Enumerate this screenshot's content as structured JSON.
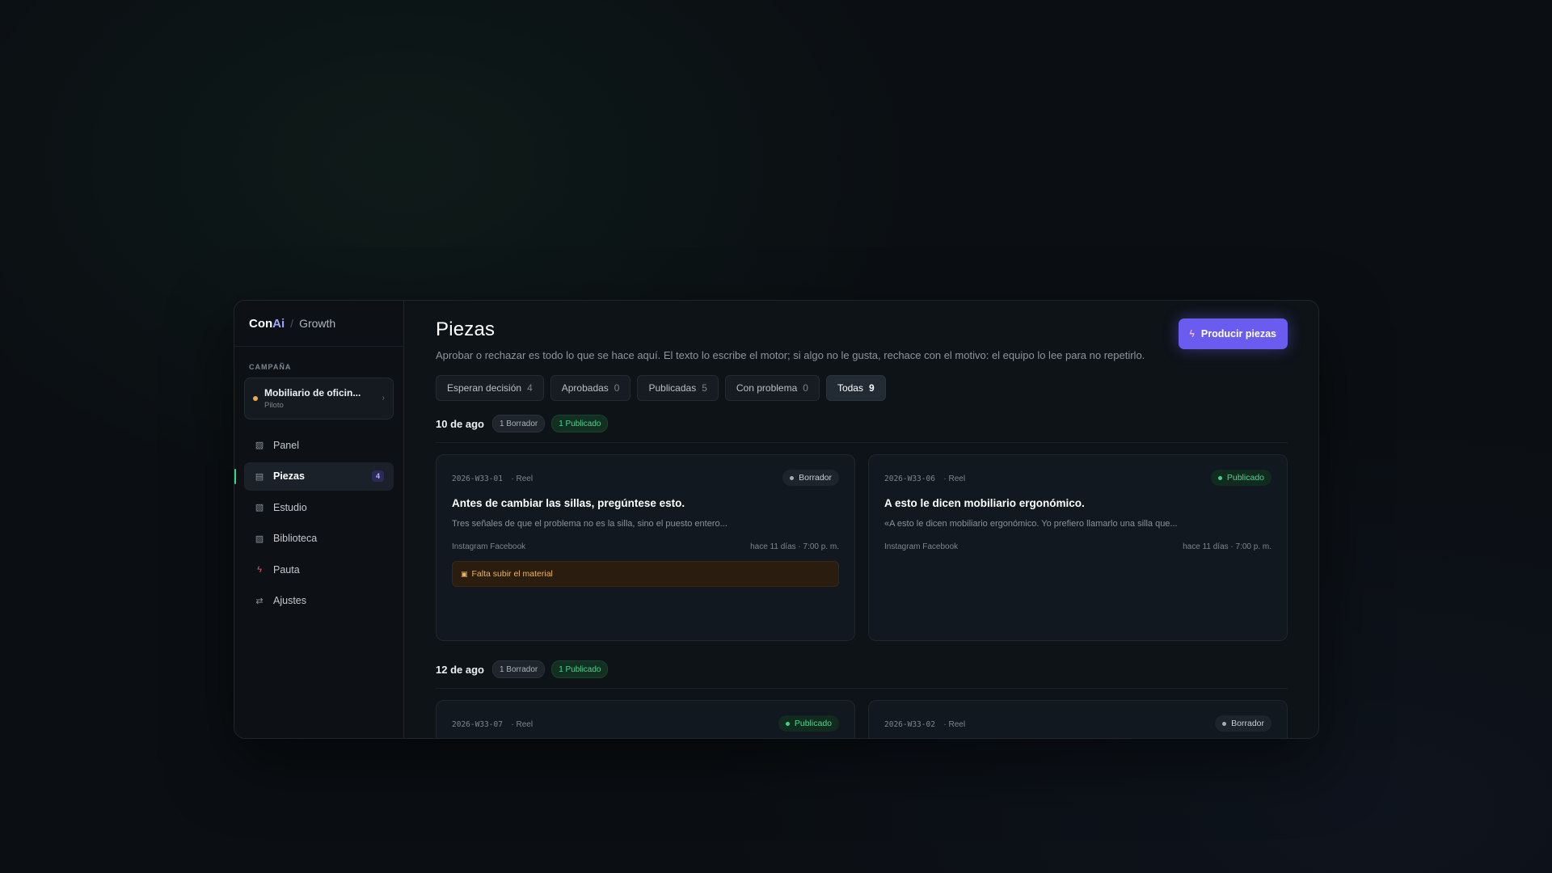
{
  "brand": {
    "name_prefix": "Con",
    "name_suffix": "Ai",
    "product": "Growth"
  },
  "sidebar": {
    "section_label": "CAMPAÑA",
    "campaign": {
      "name": "Mobiliario de oficin...",
      "stage": "Piloto"
    },
    "items": [
      {
        "label": "Panel",
        "icon": "panel-icon",
        "glyph": "▨"
      },
      {
        "label": "Piezas",
        "icon": "pieces-icon",
        "glyph": "▤",
        "badge": "4",
        "active": true
      },
      {
        "label": "Estudio",
        "icon": "studio-icon",
        "glyph": "▧"
      },
      {
        "label": "Biblioteca",
        "icon": "library-icon",
        "glyph": "▨"
      },
      {
        "label": "Pauta",
        "icon": "bolt-icon",
        "glyph": "ϟ"
      },
      {
        "label": "Ajustes",
        "icon": "swap-icon",
        "glyph": "⇄"
      }
    ]
  },
  "main": {
    "title": "Piezas",
    "description": "Aprobar o rechazar es todo lo que se hace aquí. El texto lo escribe el motor; si algo no le gusta, rechace con el motivo: el equipo lo lee para no repetirlo.",
    "primary_button": "Producir piezas",
    "filters": [
      {
        "label": "Esperan decisión",
        "count": "4"
      },
      {
        "label": "Aprobadas",
        "count": "0"
      },
      {
        "label": "Publicadas",
        "count": "5"
      },
      {
        "label": "Con problema",
        "count": "0"
      },
      {
        "label": "Todas",
        "count": "9",
        "active": true
      }
    ],
    "groups": [
      {
        "date": "10 de ago",
        "draft_pill": "1 Borrador",
        "pub_pill": "1 Publicado",
        "cards": [
          {
            "code": "2026-W33-01",
            "type": "· Reel",
            "status": "Borrador",
            "status_kind": "draft",
            "title": "Antes de cambiar las sillas, pregúntese esto.",
            "excerpt": "Tres señales de que el problema no es la silla, sino el puesto entero...",
            "platforms": "Instagram Facebook",
            "time": "hace 11 días · 7:00 p. m.",
            "warning": "Falta subir el material"
          },
          {
            "code": "2026-W33-06",
            "type": "· Reel",
            "status": "Publicado",
            "status_kind": "pub",
            "title": "A esto le dicen mobiliario ergonómico.",
            "excerpt": "«A esto le dicen mobiliario ergonómico. Yo prefiero llamarlo una silla que...",
            "platforms": "Instagram Facebook",
            "time": "hace 11 días · 7:00 p. m."
          }
        ]
      },
      {
        "date": "12 de ago",
        "draft_pill": "1 Borrador",
        "pub_pill": "1 Publicado",
        "cards": [
          {
            "code": "2026-W33-07",
            "type": "· Reel",
            "status": "Publicado",
            "status_kind": "pub"
          },
          {
            "code": "2026-W33-02",
            "type": "· Reel",
            "status": "Borrador",
            "status_kind": "draft"
          }
        ]
      }
    ]
  },
  "colors": {
    "accent": "#6b5cf0",
    "active_indicator": "#3bd28a",
    "published": "#4fd18e",
    "warning": "#f0b35a",
    "campaign_dot": "#f0a94a"
  }
}
